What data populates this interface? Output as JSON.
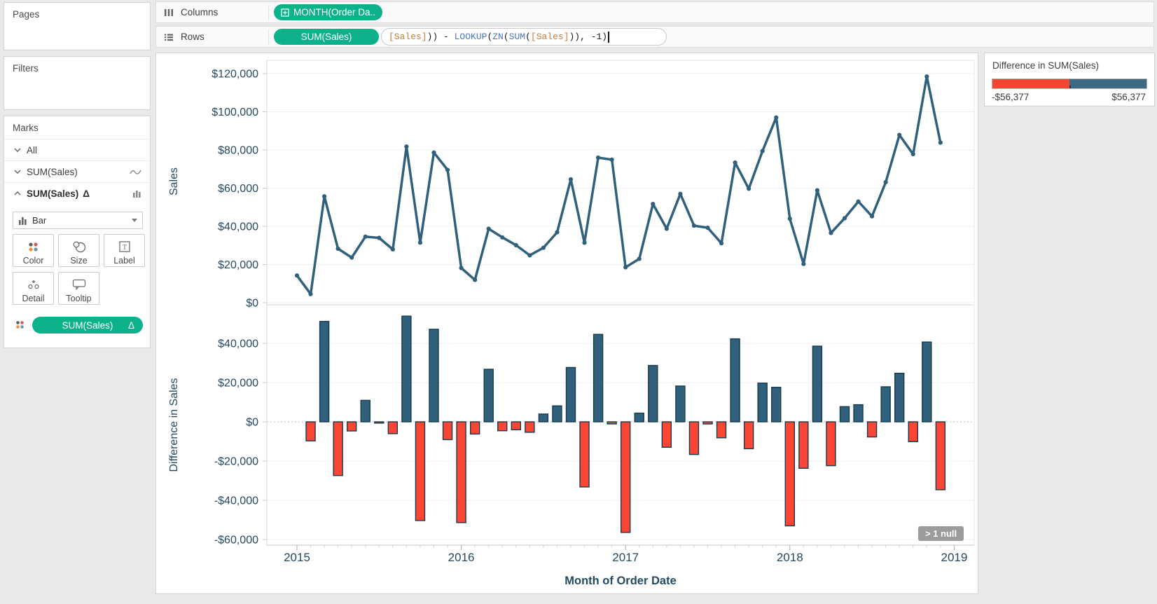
{
  "colors": {
    "accent_green": "#0db18a",
    "line_blue": "#30607b",
    "bar_positive": "#30607b",
    "bar_negative": "#fb4535",
    "bar_border": "#173a4f",
    "legend_negative": "#f34632",
    "legend_positive": "#3c6a84",
    "axis_text": "#234a63",
    "field_orange": "#c87d3e",
    "func_blue": "#4b77c0",
    "null_badge_bg": "#9b9b9b"
  },
  "panels": {
    "pages": {
      "title": "Pages"
    },
    "filters": {
      "title": "Filters"
    },
    "marks": {
      "title": "Marks",
      "cards": [
        {
          "label": "All"
        },
        {
          "label": "SUM(Sales)"
        },
        {
          "label": "SUM(Sales)",
          "delta": "Δ"
        }
      ],
      "mark_type": "Bar",
      "buttons": [
        {
          "label": "Color"
        },
        {
          "label": "Size"
        },
        {
          "label": "Label"
        },
        {
          "label": "Detail"
        },
        {
          "label": "Tooltip"
        }
      ],
      "encoding_pill": {
        "label": "SUM(Sales)",
        "delta": "Δ"
      }
    }
  },
  "shelves": {
    "columns": {
      "label": "Columns",
      "pill": "MONTH(Order Da.."
    },
    "rows": {
      "label": "Rows",
      "pill": "SUM(Sales)",
      "formula_segments": [
        {
          "text": "[Sales]",
          "type": "field"
        },
        {
          "text": ")) - ",
          "type": "plain"
        },
        {
          "text": "LOOKUP",
          "type": "func"
        },
        {
          "text": "(",
          "type": "plain"
        },
        {
          "text": "ZN",
          "type": "func"
        },
        {
          "text": "(",
          "type": "plain"
        },
        {
          "text": "SUM",
          "type": "func"
        },
        {
          "text": "(",
          "type": "plain"
        },
        {
          "text": "[Sales]",
          "type": "field"
        },
        {
          "text": ")), -1)",
          "type": "plain"
        }
      ]
    }
  },
  "legend": {
    "title": "Difference in SUM(Sales)",
    "min_label": "-$56,377",
    "max_label": "$56,377"
  },
  "chart_data": {
    "type": "line+bar",
    "x_axis": {
      "title": "Month of Order Date",
      "months_total": 48,
      "years": [
        {
          "label": "2015",
          "month_index": 0
        },
        {
          "label": "2016",
          "month_index": 12
        },
        {
          "label": "2017",
          "month_index": 24
        },
        {
          "label": "2018",
          "month_index": 36
        },
        {
          "label": "2019",
          "month_index": 48
        }
      ]
    },
    "line": {
      "ylabel": "Sales",
      "ylim": [
        0,
        120000
      ],
      "yticks": [
        {
          "value": 0,
          "label": "$0"
        },
        {
          "value": 20000,
          "label": "$20,000"
        },
        {
          "value": 40000,
          "label": "$40,000"
        },
        {
          "value": 60000,
          "label": "$60,000"
        },
        {
          "value": 80000,
          "label": "$80,000"
        },
        {
          "value": 100000,
          "label": "$100,000"
        },
        {
          "value": 120000,
          "label": "$120,000"
        }
      ],
      "values": [
        14237,
        4520,
        55691,
        28295,
        23648,
        34595,
        33946,
        27909,
        81777,
        31453,
        78629,
        69546,
        18174,
        11951,
        38726,
        34195,
        30131,
        24797,
        28765,
        36898,
        64595,
        31404,
        75973,
        74920,
        18542,
        22978,
        51715,
        38750,
        56988,
        40344,
        39262,
        31115,
        73410,
        59687,
        79411,
        96999,
        43971,
        20301,
        58872,
        36522,
        44261,
        52982,
        45264,
        63121,
        87867,
        77777,
        118448,
        83829
      ]
    },
    "bar": {
      "ylabel": "Difference in Sales",
      "derivation": "difference from previous month of SUM(Sales); first month is null",
      "ylim": [
        -62000,
        60000
      ],
      "yticks": [
        {
          "value": 40000,
          "label": "$40,000"
        },
        {
          "value": 20000,
          "label": "$20,000"
        },
        {
          "value": 0,
          "label": "$0"
        },
        {
          "value": -20000,
          "label": "-$20,000"
        },
        {
          "value": -40000,
          "label": "-$40,000"
        },
        {
          "value": -60000,
          "label": "-$60,000"
        }
      ],
      "null_badge": "> 1 null"
    }
  }
}
